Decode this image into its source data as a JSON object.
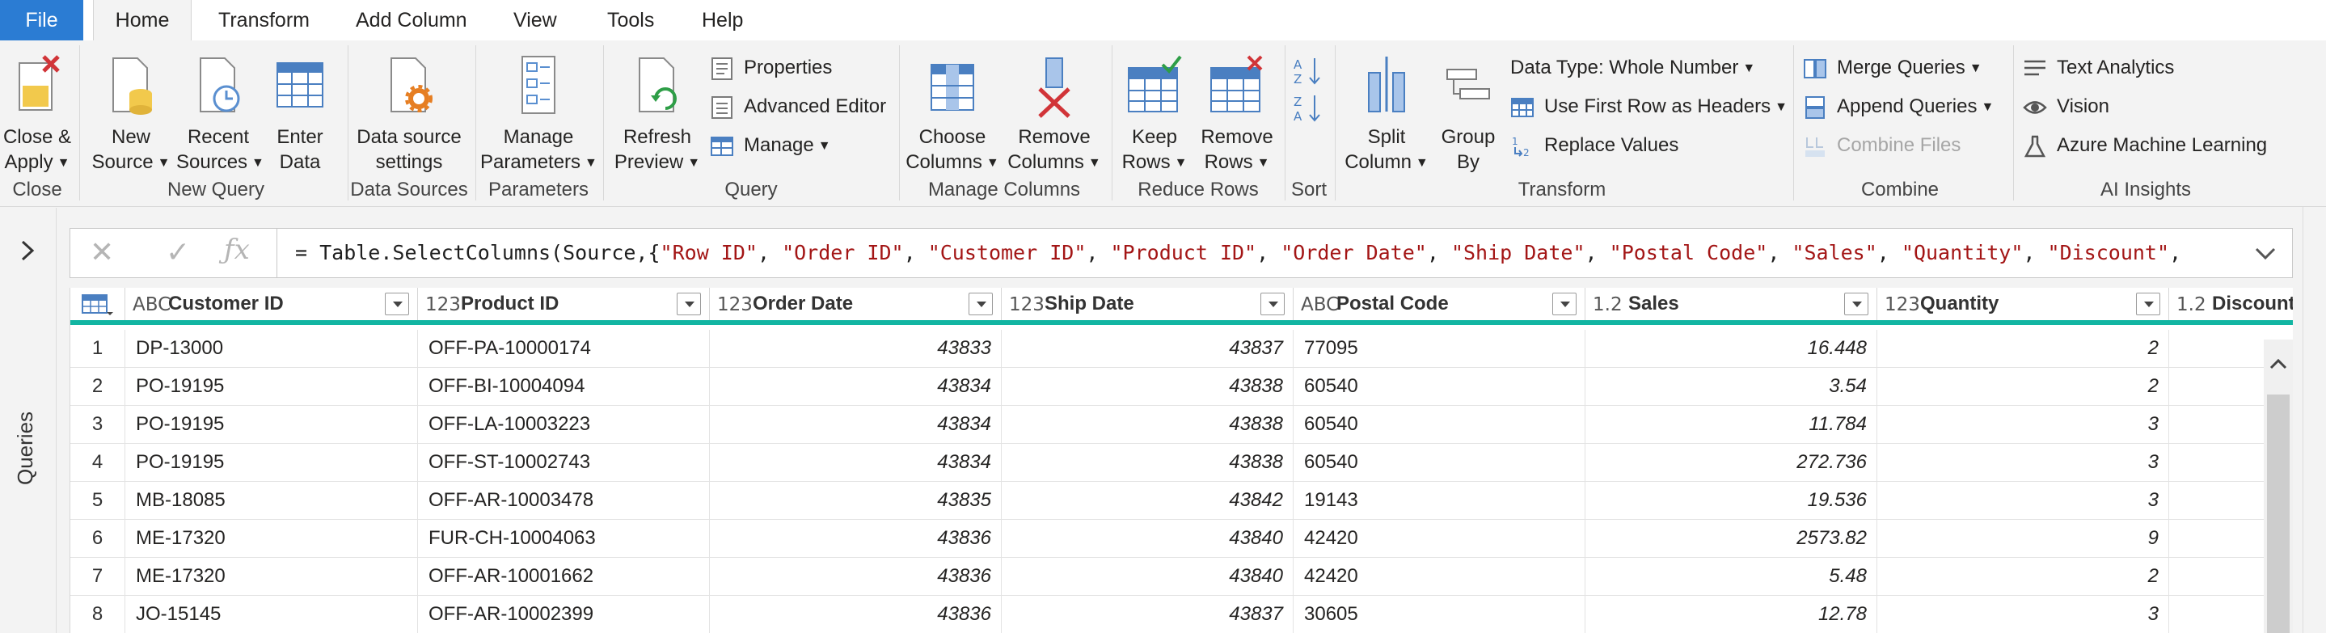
{
  "menu": {
    "file": "File",
    "tabs": [
      "Home",
      "Transform",
      "Add Column",
      "View",
      "Tools",
      "Help"
    ]
  },
  "ribbon": {
    "close": {
      "close_apply": [
        "Close &",
        "Apply"
      ],
      "label": "Close"
    },
    "new_query": {
      "new_source": [
        "New",
        "Source"
      ],
      "recent_sources": [
        "Recent",
        "Sources"
      ],
      "enter_data": [
        "Enter",
        "Data"
      ],
      "label": "New Query"
    },
    "data_sources": {
      "settings": [
        "Data source",
        "settings"
      ],
      "label": "Data Sources"
    },
    "parameters": {
      "manage": [
        "Manage",
        "Parameters"
      ],
      "label": "Parameters"
    },
    "query": {
      "refresh": [
        "Refresh",
        "Preview"
      ],
      "properties": "Properties",
      "advanced_editor": "Advanced Editor",
      "manage": "Manage",
      "label": "Query"
    },
    "manage_columns": {
      "choose": [
        "Choose",
        "Columns"
      ],
      "remove": [
        "Remove",
        "Columns"
      ],
      "label": "Manage Columns"
    },
    "reduce_rows": {
      "keep": [
        "Keep",
        "Rows"
      ],
      "remove": [
        "Remove",
        "Rows"
      ],
      "label": "Reduce Rows"
    },
    "sort": {
      "label": "Sort"
    },
    "transform": {
      "split": [
        "Split",
        "Column"
      ],
      "group_by": [
        "Group",
        "By"
      ],
      "data_type": "Data Type: Whole Number",
      "first_row": "Use First Row as Headers",
      "replace": "Replace Values",
      "label": "Transform"
    },
    "combine": {
      "merge": "Merge Queries",
      "append": "Append Queries",
      "combine_files": "Combine Files",
      "label": "Combine"
    },
    "ai_insights": {
      "text_analytics": "Text Analytics",
      "vision": "Vision",
      "azure_ml": "Azure Machine Learning",
      "label": "AI Insights"
    }
  },
  "queries_label": "Queries",
  "formula": {
    "prefix": "= Table.SelectColumns(Source,{",
    "strings": [
      "\"Row ID\"",
      "\"Order ID\"",
      "\"Customer ID\"",
      "\"Product ID\"",
      "\"Order Date\"",
      "\"Ship Date\"",
      "\"Postal Code\"",
      "\"Sales\"",
      "\"Quantity\"",
      "\"Discount\""
    ]
  },
  "grid": {
    "columns": [
      {
        "type": "ABC",
        "name": "Customer ID"
      },
      {
        "type": "123",
        "name": "Product ID"
      },
      {
        "type": "123",
        "name": "Order Date"
      },
      {
        "type": "123",
        "name": "Ship Date"
      },
      {
        "type": "ABC",
        "name": "Postal Code"
      },
      {
        "type": "1.2",
        "name": "Sales"
      },
      {
        "type": "123",
        "name": "Quantity"
      },
      {
        "type": "1.2",
        "name": "Discount"
      }
    ],
    "rows": [
      {
        "n": "1",
        "customer": "DP-13000",
        "product": "OFF-PA-10000174",
        "order_date": "43833",
        "ship_date": "43837",
        "postal": "77095",
        "sales": "16.448",
        "quantity": "2"
      },
      {
        "n": "2",
        "customer": "PO-19195",
        "product": "OFF-BI-10004094",
        "order_date": "43834",
        "ship_date": "43838",
        "postal": "60540",
        "sales": "3.54",
        "quantity": "2"
      },
      {
        "n": "3",
        "customer": "PO-19195",
        "product": "OFF-LA-10003223",
        "order_date": "43834",
        "ship_date": "43838",
        "postal": "60540",
        "sales": "11.784",
        "quantity": "3"
      },
      {
        "n": "4",
        "customer": "PO-19195",
        "product": "OFF-ST-10002743",
        "order_date": "43834",
        "ship_date": "43838",
        "postal": "60540",
        "sales": "272.736",
        "quantity": "3"
      },
      {
        "n": "5",
        "customer": "MB-18085",
        "product": "OFF-AR-10003478",
        "order_date": "43835",
        "ship_date": "43842",
        "postal": "19143",
        "sales": "19.536",
        "quantity": "3"
      },
      {
        "n": "6",
        "customer": "ME-17320",
        "product": "FUR-CH-10004063",
        "order_date": "43836",
        "ship_date": "43840",
        "postal": "42420",
        "sales": "2573.82",
        "quantity": "9"
      },
      {
        "n": "7",
        "customer": "ME-17320",
        "product": "OFF-AR-10001662",
        "order_date": "43836",
        "ship_date": "43840",
        "postal": "42420",
        "sales": "5.48",
        "quantity": "2"
      },
      {
        "n": "8",
        "customer": "JO-15145",
        "product": "OFF-AR-10002399",
        "order_date": "43836",
        "ship_date": "43837",
        "postal": "30605",
        "sales": "12.78",
        "quantity": "3"
      }
    ]
  },
  "colors": {
    "file_tab": "#2b7cd3",
    "header_underline": "#12b5a2",
    "formula_string": "#a31515"
  },
  "icons": [
    "close-apply-icon",
    "new-source-icon",
    "recent-sources-icon",
    "enter-data-icon",
    "data-source-settings-icon",
    "manage-parameters-icon",
    "refresh-preview-icon",
    "properties-icon",
    "advanced-editor-icon",
    "manage-icon",
    "choose-columns-icon",
    "remove-columns-icon",
    "keep-rows-icon",
    "remove-rows-icon",
    "sort-ascending-icon",
    "sort-descending-icon",
    "split-column-icon",
    "group-by-icon",
    "first-row-headers-icon",
    "replace-values-icon",
    "merge-queries-icon",
    "append-queries-icon",
    "combine-files-icon",
    "text-analytics-icon",
    "vision-icon",
    "azure-ml-icon"
  ]
}
